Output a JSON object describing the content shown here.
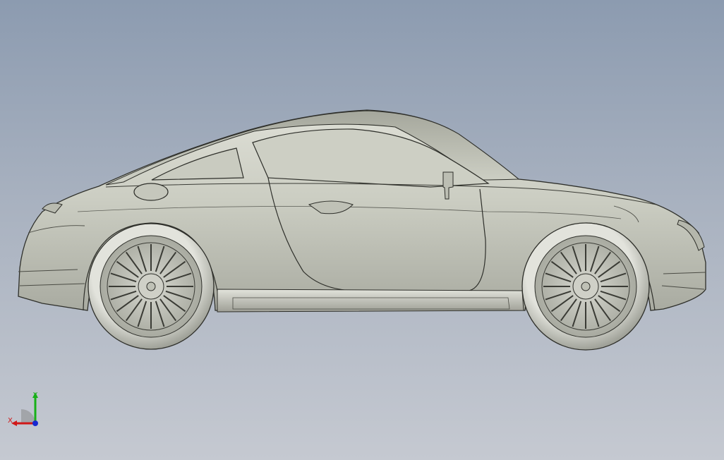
{
  "viewport": {
    "background_top": "#8c9bb0",
    "background_bottom": "#c5c9d1",
    "model": "car-coupe-side-view",
    "shading": "shaded-with-edges"
  },
  "triad": {
    "x_label": "X",
    "y_label": "Y",
    "x_color": "#d01818",
    "y_color": "#18b018",
    "z_color": "#1828d0"
  }
}
